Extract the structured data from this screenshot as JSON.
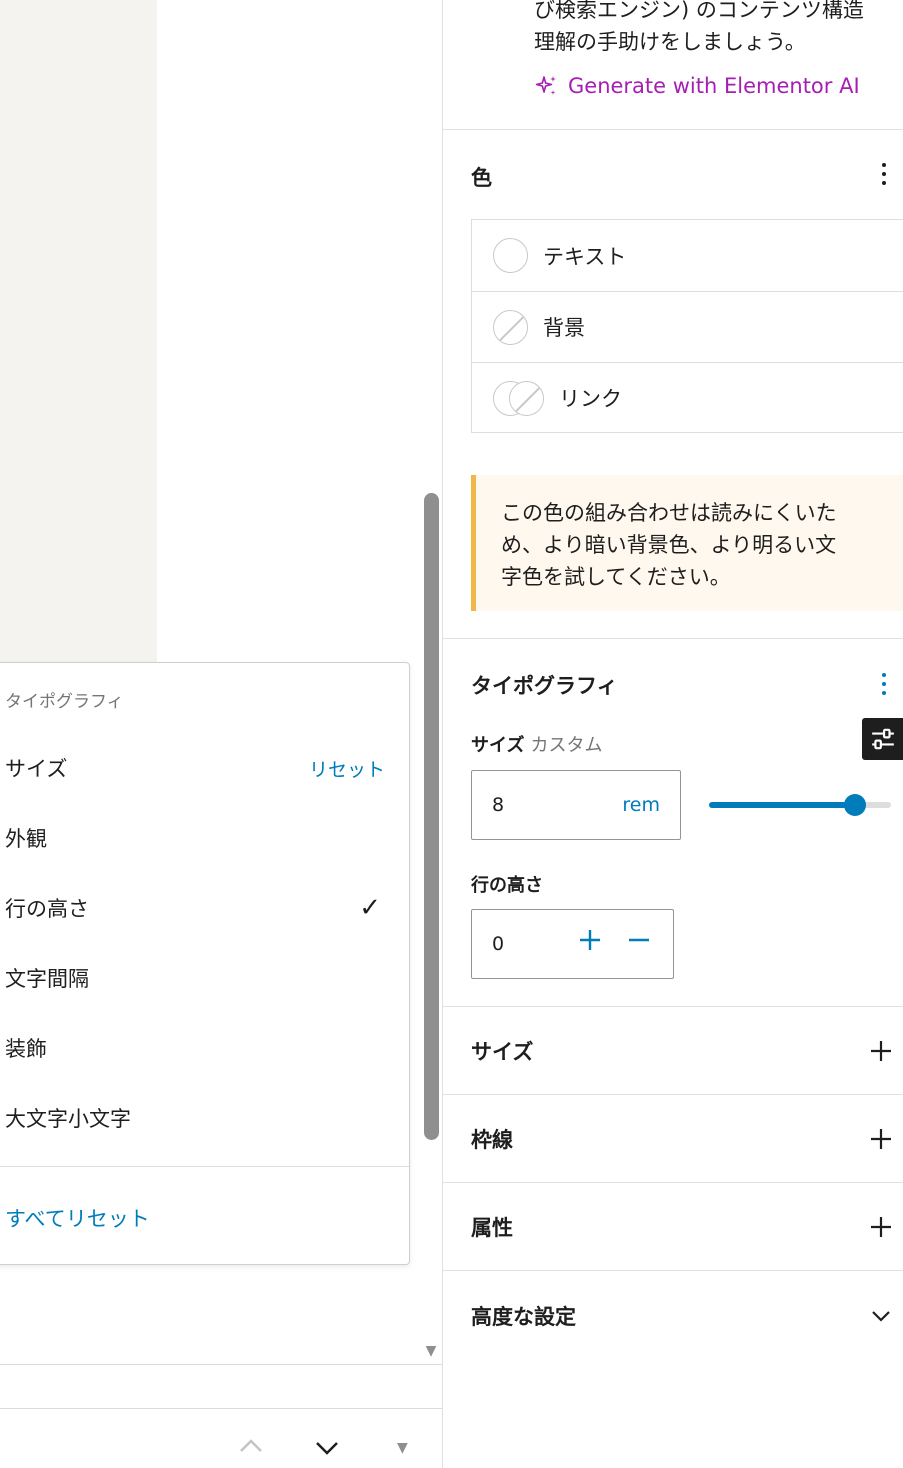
{
  "sidebar": {
    "intro_text": "び検索エンジン) のコンテンツ構造\n理解の手助けをしましょう。",
    "ai_link": "Generate with Elementor AI",
    "color_panel": {
      "title": "色",
      "items": [
        {
          "label": "テキスト"
        },
        {
          "label": "背景"
        },
        {
          "label": "リンク"
        }
      ]
    },
    "contrast_notice": "この色の組み合わせは読みにくいた\nめ、より暗い背景色、より明るい文\n字色を試してください。",
    "typography": {
      "title": "タイポグラフィ",
      "size_label": "サイズ",
      "size_mode": "カスタム",
      "size_value": "8",
      "size_unit": "rem",
      "slider_fraction": 0.8,
      "line_height_label": "行の高さ",
      "line_height_value": "0"
    },
    "sections": [
      {
        "label": "サイズ"
      },
      {
        "label": "枠線"
      },
      {
        "label": "属性"
      },
      {
        "label": "高度な設定"
      }
    ]
  },
  "dropdown": {
    "heading": "タイポグラフィ",
    "items": [
      {
        "label": "サイズ",
        "action": "リセット"
      },
      {
        "label": "外観"
      },
      {
        "label": "行の高さ",
        "checked": "✓"
      },
      {
        "label": "文字間隔"
      },
      {
        "label": "装飾"
      },
      {
        "label": "大文字小文字"
      }
    ],
    "reset_all": "すべてリセット"
  },
  "colors": {
    "accent": "#007cba",
    "ai": "#a61eb4",
    "notice_bg": "#fef8ee",
    "notice_border": "#f0b849"
  }
}
